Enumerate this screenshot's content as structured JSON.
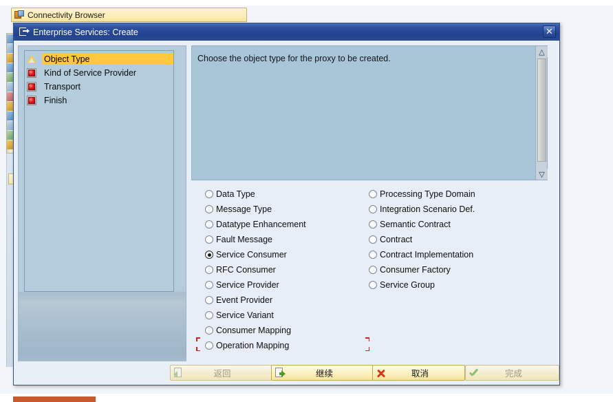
{
  "background": {
    "tab": {
      "label": "Connectivity Browser",
      "icon": "connectivity-browser-icon"
    },
    "vertical_toolbar_icons": [
      "toolbar-icon-1",
      "toolbar-icon-2",
      "toolbar-icon-3",
      "toolbar-icon-4",
      "toolbar-icon-5",
      "toolbar-icon-6",
      "toolbar-icon-7",
      "toolbar-icon-8",
      "toolbar-icon-9",
      "toolbar-icon-10",
      "toolbar-icon-11",
      "toolbar-icon-12"
    ]
  },
  "dialog": {
    "title": "Enterprise Services: Create",
    "title_icon": "document-arrow-icon",
    "close_icon": "close-icon",
    "steps": [
      {
        "label": "Object Type",
        "icon": "warning-triangle-icon",
        "state": "active"
      },
      {
        "label": "Kind of Service Provider",
        "icon": "red-square-icon",
        "state": "pending"
      },
      {
        "label": "Transport",
        "icon": "red-square-icon",
        "state": "pending"
      },
      {
        "label": "Finish",
        "icon": "red-square-icon",
        "state": "pending"
      }
    ],
    "description": "Choose the object type for the proxy to be created.",
    "scrollbar": {
      "up_icon": "chevron-up-icon",
      "down_icon": "chevron-down-icon"
    },
    "options": {
      "selected": "Service Consumer",
      "left_column": [
        {
          "label": "Data Type",
          "selected": false
        },
        {
          "label": "Message Type",
          "selected": false
        },
        {
          "label": "Datatype Enhancement",
          "selected": false
        },
        {
          "label": "Fault Message",
          "selected": false
        },
        {
          "label": "Service Consumer",
          "selected": true
        },
        {
          "label": "RFC Consumer",
          "selected": false
        },
        {
          "label": "Service Provider",
          "selected": false
        },
        {
          "label": "Event Provider",
          "selected": false
        },
        {
          "label": "Service Variant",
          "selected": false
        },
        {
          "label": "Consumer Mapping",
          "selected": false
        },
        {
          "label": "Operation Mapping",
          "selected": false
        }
      ],
      "right_column": [
        {
          "label": "Processing Type Domain",
          "selected": false
        },
        {
          "label": "Integration Scenario Def.",
          "selected": false
        },
        {
          "label": "Semantic Contract",
          "selected": false
        },
        {
          "label": "Contract",
          "selected": false
        },
        {
          "label": "Contract Implementation",
          "selected": false
        },
        {
          "label": "Consumer Factory",
          "selected": false
        },
        {
          "label": "Service Group",
          "selected": false
        }
      ]
    },
    "buttons": {
      "back": {
        "label": "返回",
        "icon": "page-back-icon",
        "enabled": false
      },
      "continue": {
        "label": "继续",
        "icon": "page-forward-icon",
        "enabled": true
      },
      "cancel": {
        "label": "取消",
        "icon": "red-x-icon",
        "enabled": true
      },
      "finish": {
        "label": "完成",
        "icon": "green-check-icon",
        "enabled": false
      }
    }
  },
  "colors": {
    "titlebar": "#23428e",
    "step_active": "#fec93f",
    "description_bg": "#a9c5d8",
    "options_bg": "#e8eef7",
    "button_enabled": "#f6e49c",
    "focus_bracket": "#d32020"
  }
}
